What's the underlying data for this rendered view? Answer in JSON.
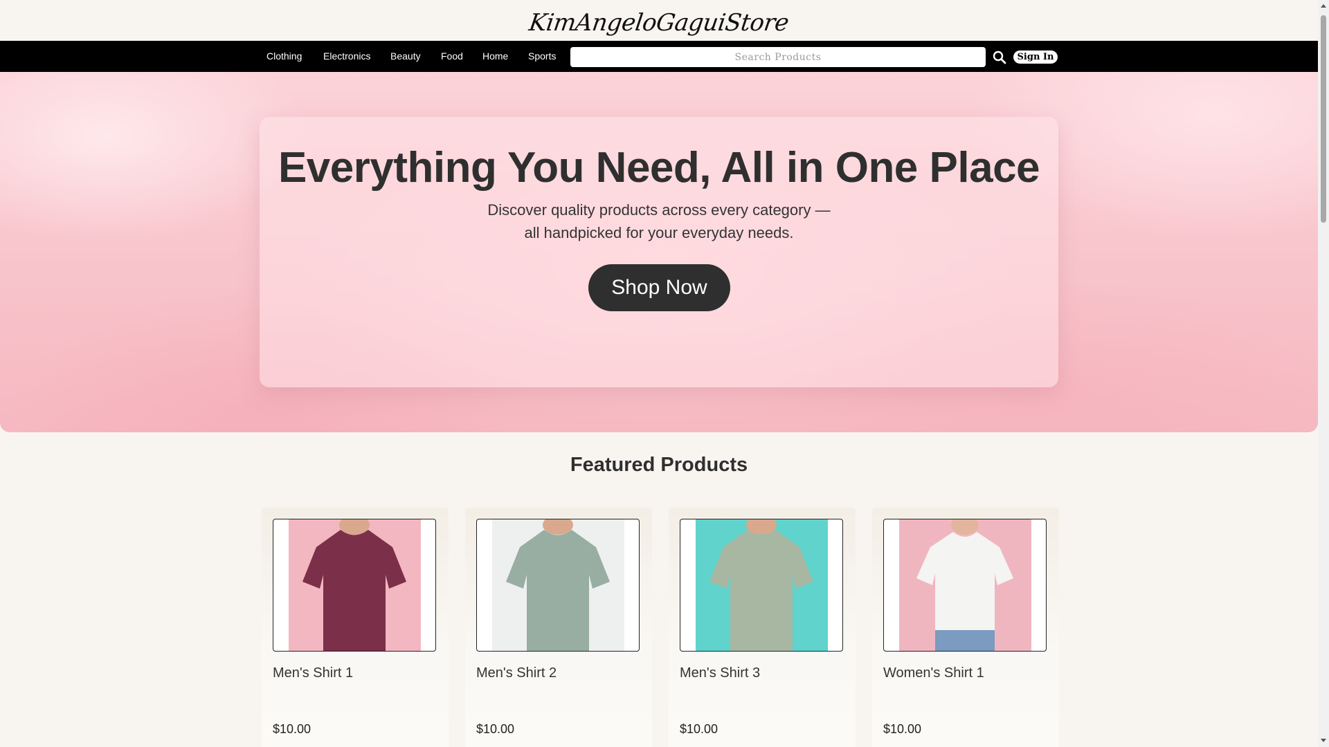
{
  "brand": {
    "name": "KimAngeloGaguiStore"
  },
  "nav": {
    "items": [
      "Clothing",
      "Electronics",
      "Beauty",
      "Food",
      "Home",
      "Sports"
    ],
    "search_placeholder": "Search Products",
    "search_value": "",
    "search_icon": "search-icon",
    "signin_label": "Sign In"
  },
  "hero": {
    "title": "Everything You Need, All in One Place",
    "subtitle_line1": "Discover quality products across every category —",
    "subtitle_line2": "all handpicked for your everyday needs.",
    "cta_label": "Shop Now"
  },
  "featured": {
    "title": "Featured Products",
    "products": [
      {
        "name": "Men's Shirt 1",
        "price": "$10.00",
        "shirt_color": "#7c2f48",
        "bg_color": "#f2b7c1"
      },
      {
        "name": "Men's Shirt 2",
        "price": "$10.00",
        "shirt_color": "#98aea3",
        "bg_color": "#eef0ef"
      },
      {
        "name": "Men's Shirt 3",
        "price": "$10.00",
        "shirt_color": "#a7b7a2",
        "bg_color": "#5fd3cc"
      },
      {
        "name": "Women's Shirt 1",
        "price": "$10.00",
        "shirt_color": "#f4f4f2",
        "bg_color": "#f0b6c0"
      }
    ]
  },
  "colors": {
    "page_bg": "#f8f5f1",
    "nav_bg": "#000000",
    "cta_bg": "#2f2f2f",
    "hero_pink": "#f8c4cb"
  }
}
